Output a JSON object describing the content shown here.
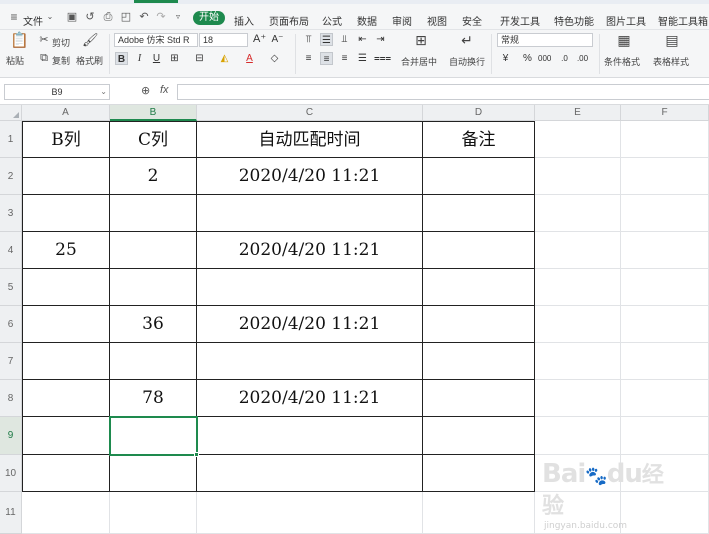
{
  "menu": {
    "file": "文件",
    "start": "开始",
    "tabs": [
      "插入",
      "页面布局",
      "公式",
      "数据",
      "审阅",
      "视图",
      "安全",
      "开发工具",
      "特色功能",
      "图片工具",
      "智能工具箱"
    ]
  },
  "ribbon": {
    "paste": "粘贴",
    "cut": "剪切",
    "copy": "复制",
    "format_painter": "格式刷",
    "font_name": "Adobe 仿宋 Std R",
    "font_size": "18",
    "merge_center": "合并居中",
    "wrap_text": "自动换行",
    "number_format": "常规",
    "conditional_format": "条件格式",
    "table_style": "表格样式"
  },
  "formula_bar": {
    "name_box": "B9",
    "fx": "fx",
    "value": ""
  },
  "columns": [
    "A",
    "B",
    "C",
    "D",
    "E",
    "F"
  ],
  "rows": [
    "1",
    "2",
    "3",
    "4",
    "5",
    "6",
    "7",
    "8",
    "9",
    "10",
    "11"
  ],
  "cells": {
    "A1": "B列",
    "B1": "C列",
    "C1": "自动匹配时间",
    "D1": "备注",
    "B2": "2",
    "C2": "2020/4/20 11:21",
    "A4": "25",
    "C4": "2020/4/20 11:21",
    "B6": "36",
    "C6": "2020/4/20 11:21",
    "B8": "78",
    "C8": "2020/4/20 11:21"
  },
  "watermark": {
    "brand": "Bai",
    "brand2": "du",
    "brand_cn": "经验",
    "url": "jingyan.baidu.com"
  },
  "colors": {
    "accent": "#1e8a4e",
    "selection": "#1e8a4e"
  }
}
